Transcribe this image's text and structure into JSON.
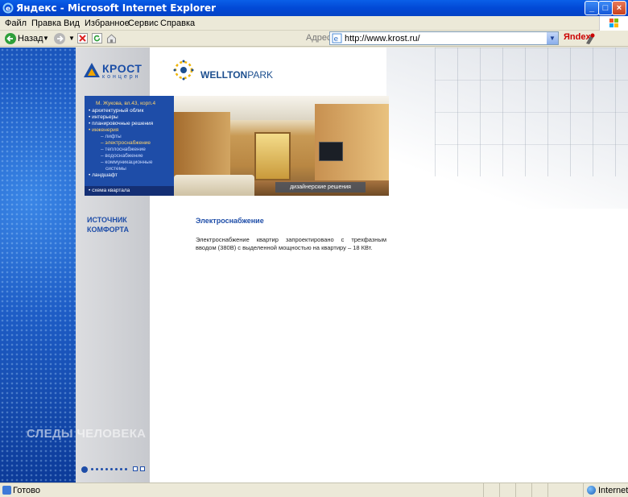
{
  "window": {
    "title": "Яндекс - Microsoft Internet Explorer",
    "minimize": "_",
    "maximize": "□",
    "close": "×"
  },
  "menubar": {
    "items": [
      "Файл",
      "Правка",
      "Вид",
      "Избранное",
      "Сервис",
      "Справка"
    ]
  },
  "toolbar": {
    "back_label": "Назад",
    "address_label": "Адрес:",
    "address_value": "http://www.krost.ru/",
    "yandex_label": "Яndex"
  },
  "page": {
    "krost_logo": "КРОСТ",
    "krost_sub": "концерн",
    "wellton_logo": "WELLTON",
    "wellton_park": "PARK",
    "banner_menu": [
      "М. Жукова, вл.43, корп.4",
      "• архитектурный облик",
      "• интерьеры",
      "• планировочные решения",
      "• инженерия",
      "– лифты",
      "– электроснабжение",
      "– теплоснабжение",
      "– водоснабжение",
      "– коммуникационные",
      "системы",
      "• ландшафт"
    ],
    "scheme_link": "• схема квартала",
    "photo_caption": "дизайнерские решения",
    "slogan_line1": "ИСТОЧНИК",
    "slogan_line2": "КОМФОРТА",
    "footer_slogan": "СЛЕДЫ ЧЕЛОВЕКА",
    "content_title": "Электроснабжение",
    "content_text": "Электроснабжение квартир запроектировано с трехфазным вводом (380В) с выделенной мощностью на квартиру – 18 КВт."
  },
  "statusbar": {
    "status": "Готово",
    "zone": "Internet"
  },
  "colors": {
    "brand_blue": "#1E4DA8",
    "xp_title": "#0249D6",
    "accent_yellow": "#FFD36A"
  }
}
